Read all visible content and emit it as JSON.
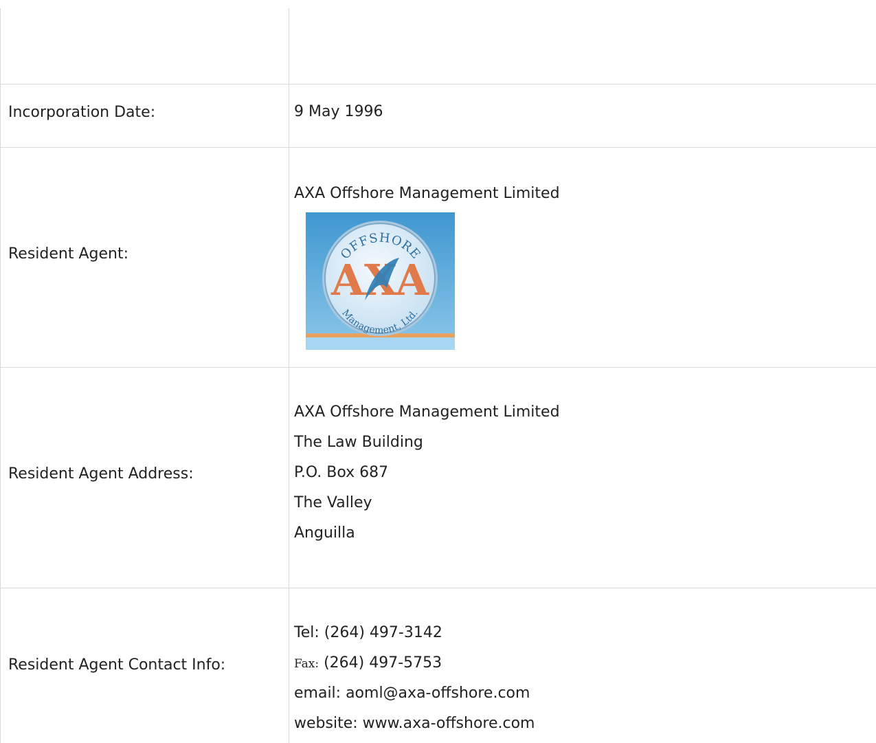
{
  "rows": {
    "incorporation": {
      "label": "Incorporation Date:",
      "value": "9 May 1996"
    },
    "agent": {
      "label": "Resident Agent:",
      "name": "AXA Offshore Management Limited",
      "logo": {
        "top_text": "OFFSHORE",
        "main_text": "AXA",
        "bottom_text": "Management, Ltd.",
        "colors": {
          "sky": "#5aa9d9",
          "coin": "#dfeef8",
          "letters": "#e07a4a",
          "dolphin": "#2f7fb5"
        }
      }
    },
    "address": {
      "label": "Resident Agent Address:",
      "lines": [
        "AXA Offshore Management Limited",
        "The Law Building",
        "P.O. Box 687",
        "The Valley",
        "Anguilla"
      ]
    },
    "contact": {
      "label": "Resident Agent Contact Info:",
      "tel": "Tel: (264) 497-3142",
      "fax_prefix": "Fax:",
      "fax": "(264) 497-5753",
      "email": "email:  aoml@axa-offshore.com",
      "website": "website:   www.axa-offshore.com"
    }
  }
}
